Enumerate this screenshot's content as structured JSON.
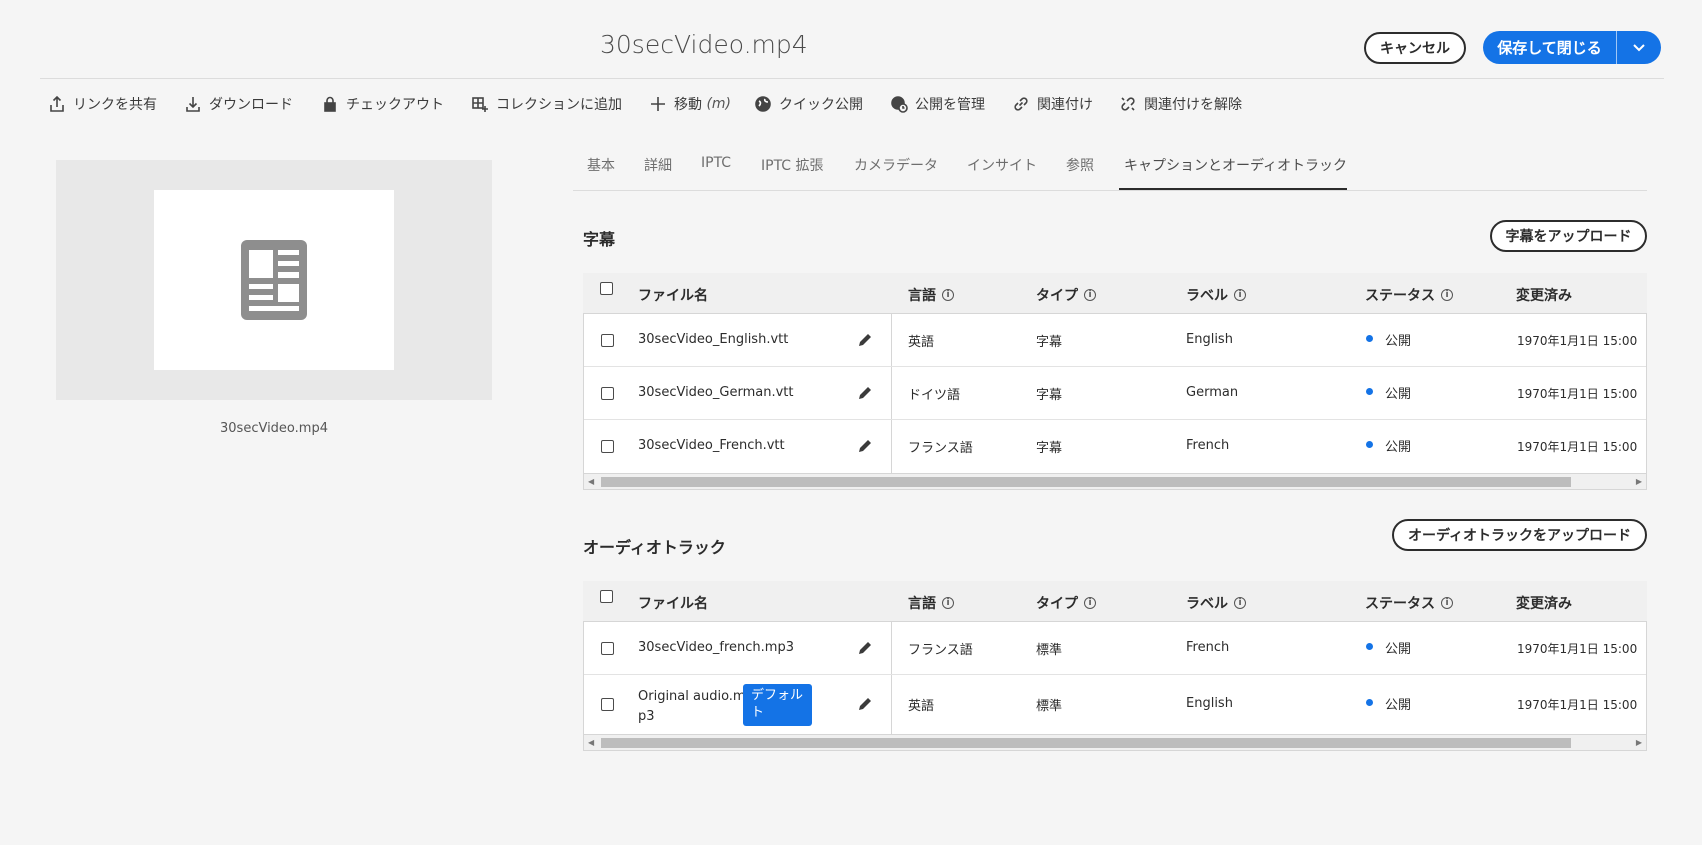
{
  "header": {
    "title": "30secVideo.mp4",
    "cancel_label": "キャンセル",
    "save_close_label": "保存して閉じる"
  },
  "toolbar": {
    "share_link": "リンクを共有",
    "download": "ダウンロード",
    "checkout": "チェックアウト",
    "add_to_collection": "コレクションに追加",
    "move": "移動",
    "move_shortcut": "(m)",
    "quick_publish": "クイック公開",
    "manage_publication": "公開を管理",
    "relate": "関連付け",
    "unrelate": "関連付けを解除"
  },
  "preview": {
    "filename": "30secVideo.mp4"
  },
  "tabs": [
    "基本",
    "詳細",
    "IPTC",
    "IPTC 拡張",
    "カメラデータ",
    "インサイト",
    "参照",
    "キャプションとオーディオトラック"
  ],
  "columns": {
    "filename": "ファイル名",
    "language": "言語",
    "type": "タイプ",
    "label": "ラベル",
    "status": "ステータス",
    "modified": "変更済み"
  },
  "captions": {
    "heading": "字幕",
    "upload_label": "字幕をアップロード",
    "rows": [
      {
        "file": "30secVideo_English.vtt",
        "language": "英語",
        "type": "字幕",
        "label": "English",
        "status": "公開",
        "modified": "1970年1月1日 15:00"
      },
      {
        "file": "30secVideo_German.vtt",
        "language": "ドイツ語",
        "type": "字幕",
        "label": "German",
        "status": "公開",
        "modified": "1970年1月1日 15:00"
      },
      {
        "file": "30secVideo_French.vtt",
        "language": "フランス語",
        "type": "字幕",
        "label": "French",
        "status": "公開",
        "modified": "1970年1月1日 15:00"
      }
    ]
  },
  "audio": {
    "heading": "オーディオトラック",
    "upload_label": "オーディオトラックをアップロード",
    "rows": [
      {
        "file": "30secVideo_french.mp3",
        "language": "フランス語",
        "type": "標準",
        "label": "French",
        "status": "公開",
        "modified": "1970年1月1日 15:00"
      },
      {
        "file_line1": "Original audio.m",
        "file_line2": "p3",
        "badge": "デフォルト",
        "language": "英語",
        "type": "標準",
        "label": "English",
        "status": "公開",
        "modified": "1970年1月1日 15:00"
      }
    ]
  },
  "colors": {
    "accent": "#1473e6",
    "status_dot": "#1473e6"
  }
}
